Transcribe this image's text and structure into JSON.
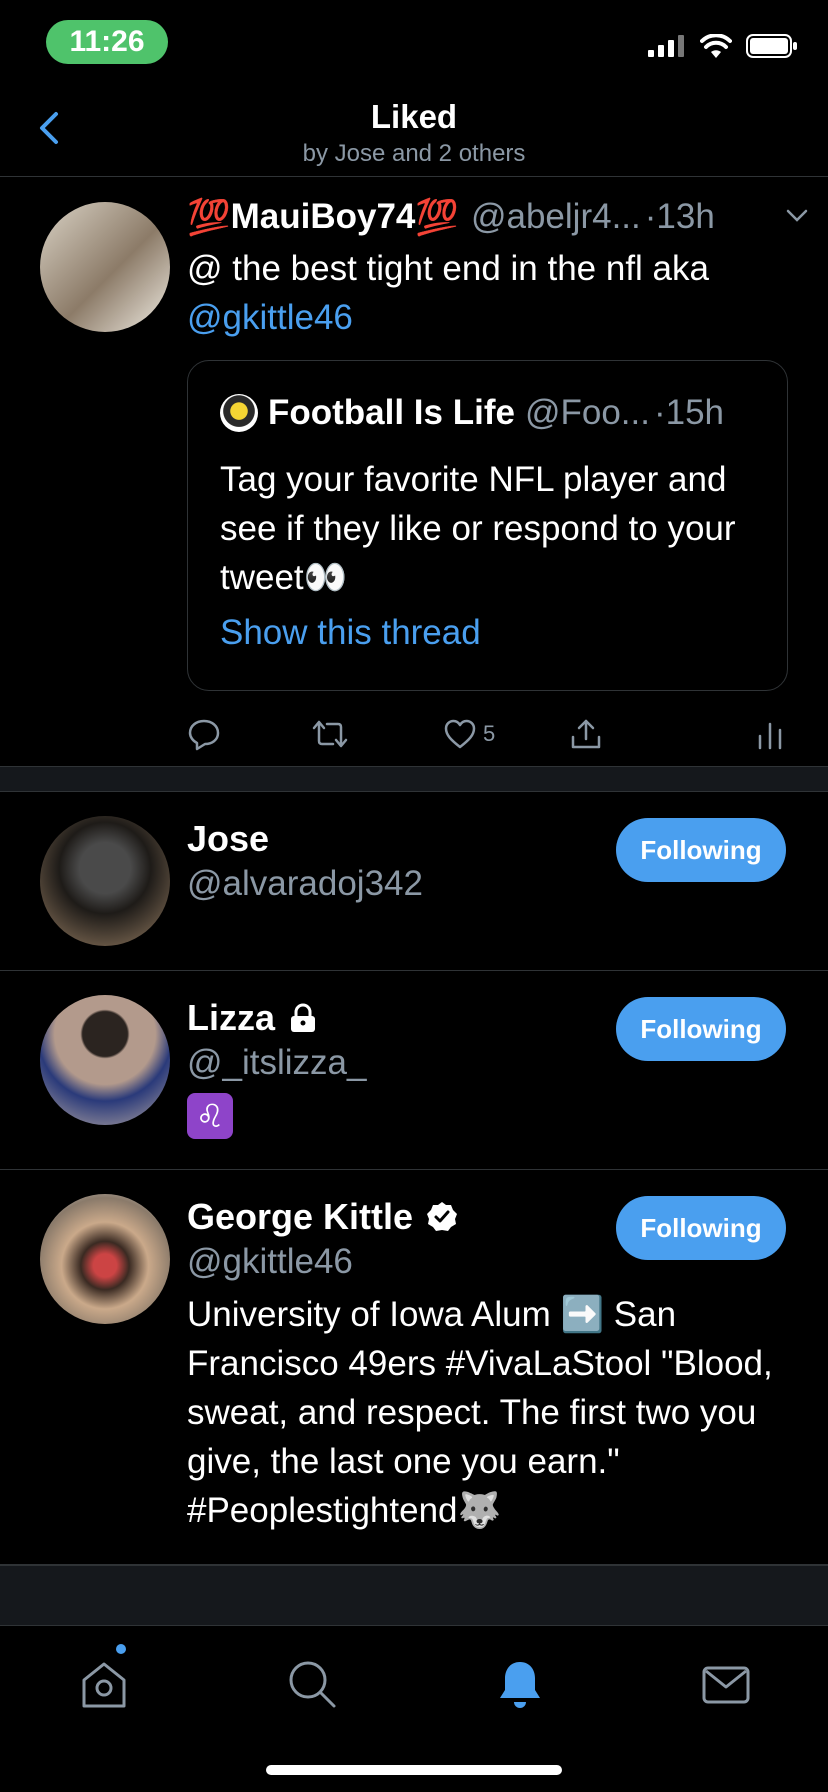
{
  "status": {
    "time": "11:26"
  },
  "nav": {
    "title": "Liked",
    "subtitle": "by Jose and 2 others"
  },
  "tweet": {
    "emoji_left": "💯",
    "name": "MauiBoy74",
    "emoji_right": "💯",
    "handle": "@abeljr4...",
    "time": "·13h",
    "text": "@ the best tight end in the nfl aka",
    "mention": "@gkittle46",
    "quote": {
      "name": "Football Is Life",
      "handle": "@Foo...",
      "time": "·15h",
      "text": "Tag your favorite NFL player and see if they like or respond to your tweet👀",
      "link": "Show this thread"
    },
    "likes": "5"
  },
  "users": [
    {
      "name": "Jose",
      "handle": "@alvaradoj342",
      "button": "Following"
    },
    {
      "name": "Lizza",
      "handle": "@_itslizza_",
      "button": "Following",
      "bio": "♌"
    },
    {
      "name": "George Kittle",
      "handle": "@gkittle46",
      "button": "Following",
      "bio": "University of Iowa Alum ➡️ San Francisco 49ers #VivaLaStool \"Blood, sweat, and respect. The first two you give, the last one you earn.\" #Peoplestightend🐺"
    }
  ],
  "colors": {
    "accent": "#4a9fef",
    "time_pill": "#4fc36b",
    "muted": "#8b98a5"
  },
  "icons": [
    "back-chevron-icon",
    "reply-icon",
    "retweet-icon",
    "like-icon",
    "share-icon",
    "analytics-icon",
    "lock-icon",
    "verified-icon",
    "home-icon",
    "search-icon",
    "notifications-icon",
    "messages-icon"
  ]
}
